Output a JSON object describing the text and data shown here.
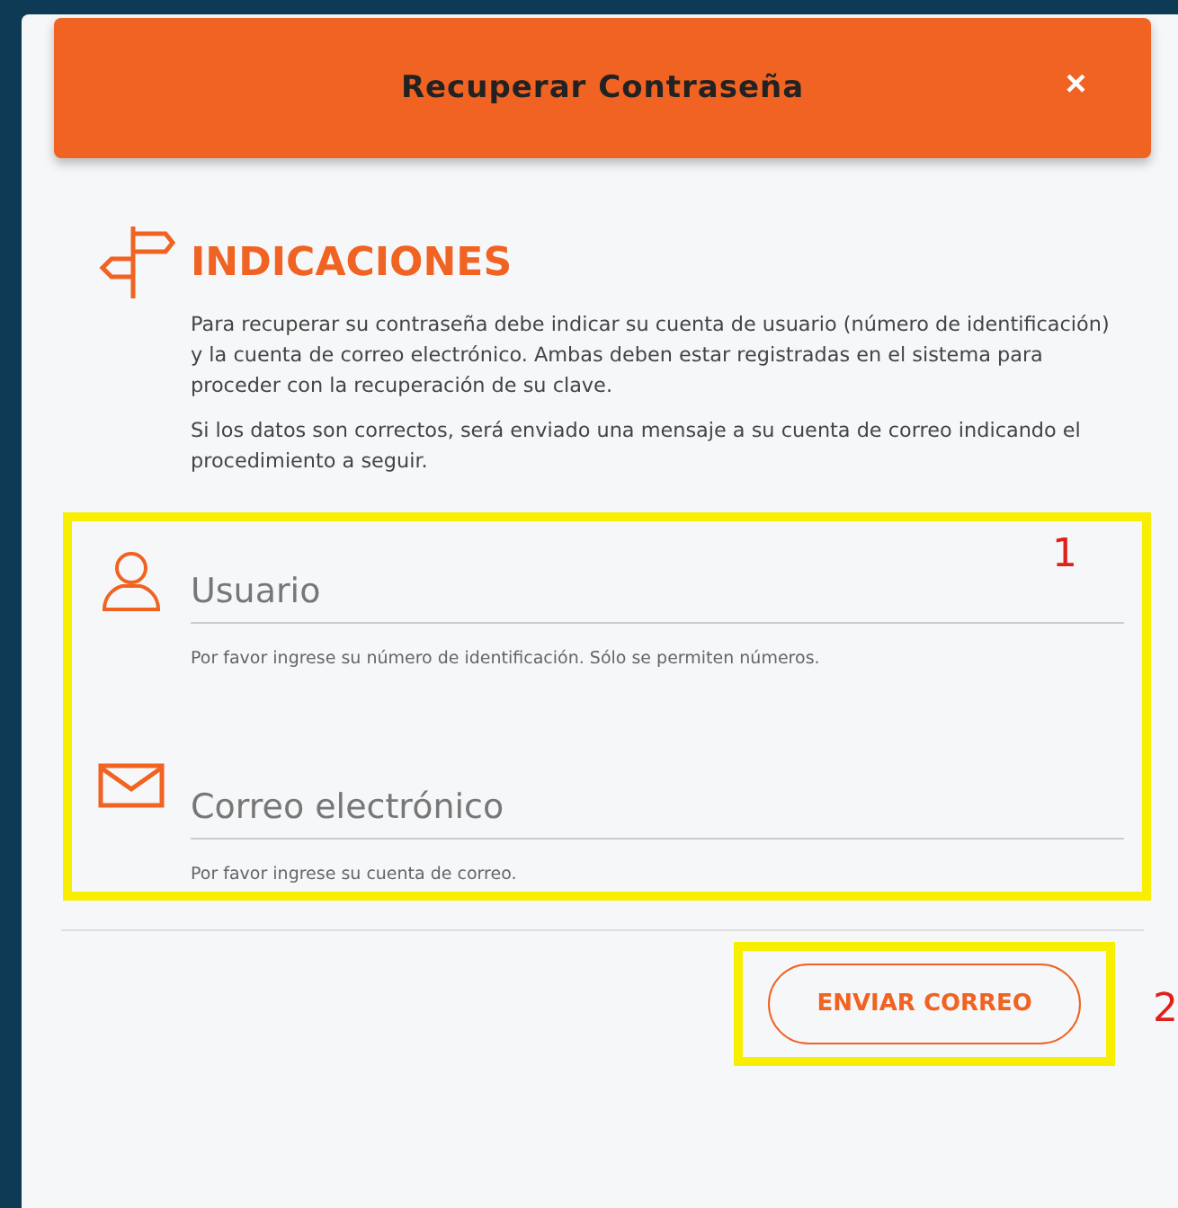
{
  "dialog": {
    "title": "Recuperar Contraseña",
    "close": "×"
  },
  "instructions": {
    "heading": "INDICACIONES",
    "paragraphs": [
      "Para recuperar su contraseña debe indicar su cuenta de usuario (número de identificación) y la cuenta de correo electrónico. Ambas deben estar registradas en el sistema para proceder con la recuperación de su clave.",
      "Si los datos son correctos, será enviado una mensaje a su cuenta de correo indicando el procedimiento a seguir."
    ]
  },
  "fields": [
    {
      "kind": "user",
      "placeholder": "Usuario",
      "hint": "Por favor ingrese su número de identificación. Sólo se permiten números."
    },
    {
      "kind": "email",
      "placeholder": "Correo electrónico",
      "hint": "Por favor ingrese su cuenta de correo."
    }
  ],
  "submit_button": "ENVIAR CORREO",
  "annotations": [
    "1",
    "2"
  ]
}
